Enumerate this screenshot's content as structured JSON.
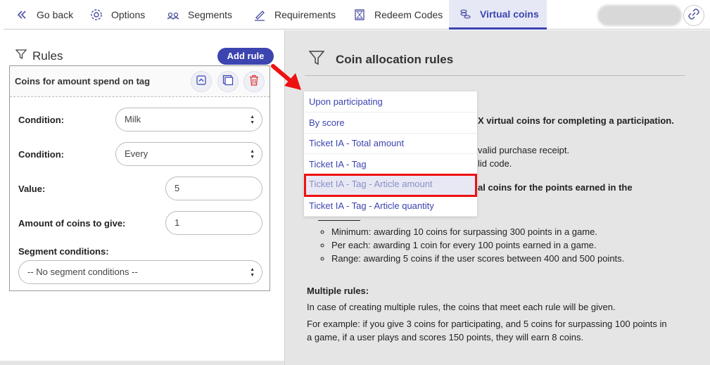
{
  "nav": {
    "go_back": "Go back",
    "options": "Options",
    "segments": "Segments",
    "requirements": "Requirements",
    "redeem_codes": "Redeem Codes",
    "virtual_coins": "Virtual coins"
  },
  "left": {
    "title": "Rules",
    "add_rule": "Add rule",
    "card": {
      "title": "Coins for amount spend on tag",
      "condition1_label": "Condition:",
      "condition1_value": "Milk",
      "condition2_label": "Condition:",
      "condition2_value": "Every",
      "value_label": "Value:",
      "value_value": "5",
      "coins_label": "Amount of coins to give:",
      "coins_value": "1",
      "segment_label": "Segment conditions:",
      "segment_value": "-- No segment conditions --"
    }
  },
  "right": {
    "title": "Coin allocation rules",
    "line1": "X virtual coins for completing a participation.",
    "line2": "valid purchase receipt.",
    "line3": "lid code.",
    "line4": "al coins for the points earned in the",
    "bullets": [
      "Minimum: awarding 10 coins for surpassing 300 points in a game.",
      "Per each: awarding 1 coin for every 100 points earned in a game.",
      "Range: awarding 5 coins if the user scores between 400 and 500 points."
    ],
    "multiple_title": "Multiple rules:",
    "multiple_p1": "In case of creating multiple rules, the coins that meet each rule will be given.",
    "multiple_p2a": "For example: if you give 3 coins for participating, and 5 coins for surpassing 100 points in",
    "multiple_p2b": "a game, if a user plays and scores 150 points, they will earn 8 coins."
  },
  "dropdown": {
    "items": [
      "Upon participating",
      "By score",
      "Ticket IA - Total amount",
      "Ticket IA - Tag",
      "Ticket IA - Tag - Article amount",
      "Ticket IA - Tag - Article quantity"
    ],
    "highlighted_index": 4
  },
  "colors": {
    "accent": "#3c44b0",
    "highlight_border": "#e11111",
    "right_bg": "#e5e5e5"
  }
}
